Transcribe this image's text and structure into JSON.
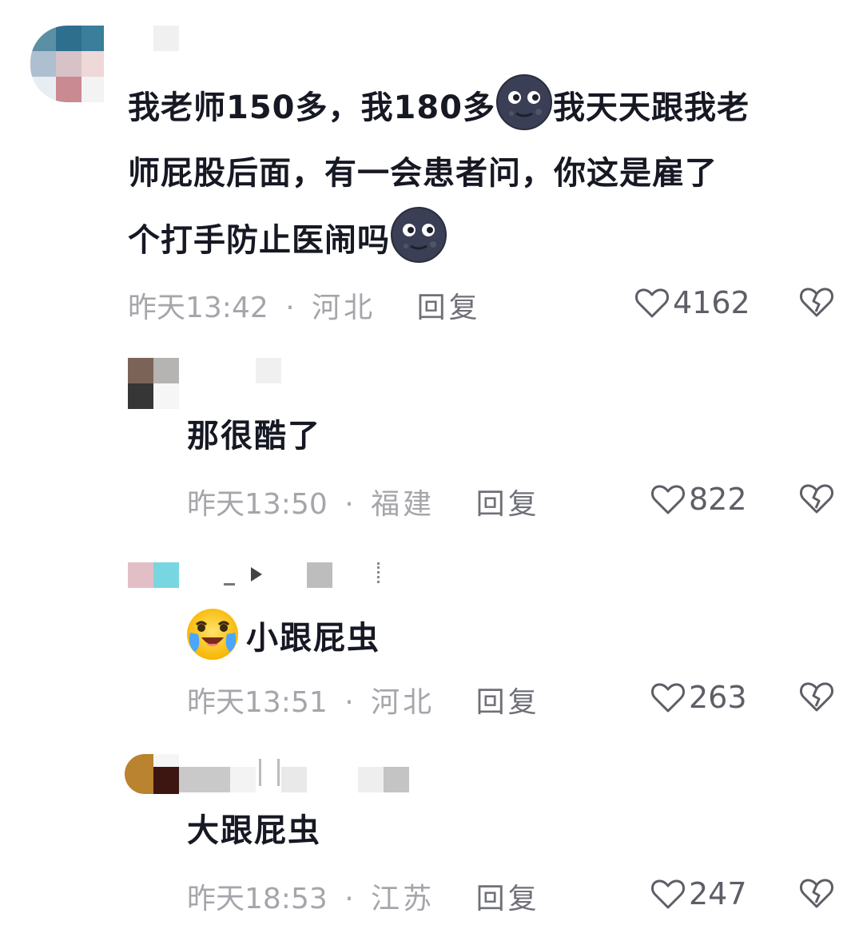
{
  "comments": [
    {
      "text_part1": "我老师150多，我180多",
      "text_part2": "我天天跟我老",
      "text_line2": "师屁股后面，有一会患者问，你这是雇了",
      "text_line3": "个打手防止医闹吗",
      "time": "昨天13:42",
      "location": "河北",
      "reply_label": "回复",
      "likes": "4162",
      "emoji_icon": "new-moon-face-icon"
    },
    {
      "text": "那很酷了",
      "time": "昨天13:50",
      "location": "福建",
      "reply_label": "回复",
      "likes": "822"
    },
    {
      "emoji_icon": "crying-face-icon",
      "text": "小跟屁虫",
      "time": "昨天13:51",
      "location": "河北",
      "reply_label": "回复",
      "likes": "263"
    },
    {
      "text": "大跟屁虫",
      "time": "昨天18:53",
      "location": "江苏",
      "reply_label": "回复",
      "likes": "247"
    }
  ],
  "separator": "·",
  "colors": {
    "text": "#161823",
    "meta": "#a5a6ab",
    "icon": "#5d5e66"
  }
}
